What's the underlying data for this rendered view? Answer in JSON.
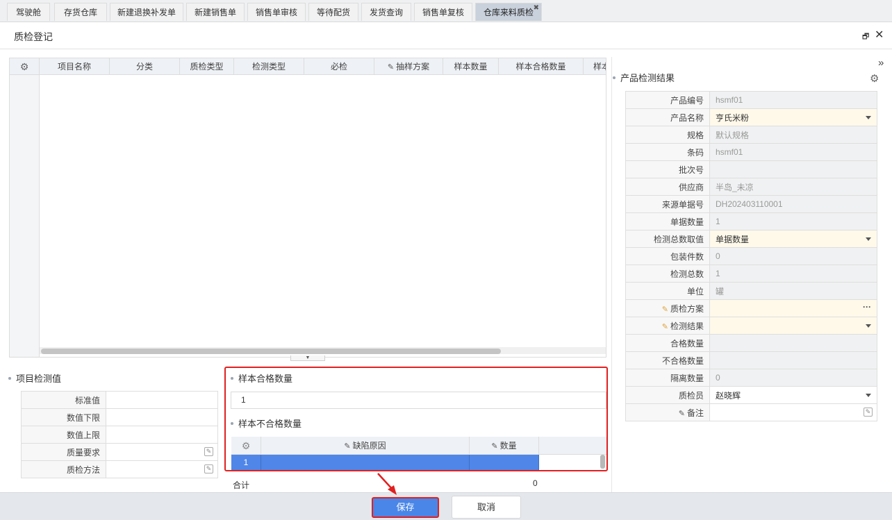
{
  "tabs": [
    {
      "label": "驾驶舱"
    },
    {
      "label": "存货仓库"
    },
    {
      "label": "新建退换补发单"
    },
    {
      "label": "新建销售单"
    },
    {
      "label": "销售单审核"
    },
    {
      "label": "等待配货"
    },
    {
      "label": "发货查询"
    },
    {
      "label": "销售单复核"
    },
    {
      "label": "仓库来料质检"
    }
  ],
  "dialog": {
    "title": "质检登记"
  },
  "grid": {
    "columns": [
      "项目名称",
      "分类",
      "质检类型",
      "检测类型",
      "必检",
      "抽样方案",
      "样本数量",
      "样本合格数量",
      "样本"
    ]
  },
  "item_values": {
    "title": "项目检测值",
    "rows": [
      {
        "label": "标准值",
        "value": ""
      },
      {
        "label": "数值下限",
        "value": ""
      },
      {
        "label": "数值上限",
        "value": ""
      },
      {
        "label": "质量要求",
        "value": ""
      },
      {
        "label": "质检方法",
        "value": ""
      }
    ]
  },
  "sample": {
    "pass_title": "样本合格数量",
    "pass_value": "1",
    "fail_title": "样本不合格数量",
    "defect_columns": [
      "缺陷原因",
      "数量"
    ],
    "defect_rows": [
      {
        "index": "1",
        "reason": "",
        "qty": ""
      }
    ],
    "total_label": "合计",
    "total_value": "0"
  },
  "result": {
    "title": "产品检测结果",
    "fields": [
      {
        "label": "产品编号",
        "value": "hsmf01"
      },
      {
        "label": "产品名称",
        "value": "亨氏米粉"
      },
      {
        "label": "规格",
        "value": "默认规格"
      },
      {
        "label": "条码",
        "value": "hsmf01"
      },
      {
        "label": "批次号",
        "value": ""
      },
      {
        "label": "供应商",
        "value": "半岛_未凉"
      },
      {
        "label": "来源单据号",
        "value": "DH202403110001"
      },
      {
        "label": "单据数量",
        "value": "1"
      },
      {
        "label": "检测总数取值",
        "value": "单据数量"
      },
      {
        "label": "包装件数",
        "value": "0"
      },
      {
        "label": "检测总数",
        "value": "1"
      },
      {
        "label": "单位",
        "value": "罐"
      },
      {
        "label": "质检方案",
        "value": ""
      },
      {
        "label": "检测结果",
        "value": ""
      },
      {
        "label": "合格数量",
        "value": ""
      },
      {
        "label": "不合格数量",
        "value": ""
      },
      {
        "label": "隔离数量",
        "value": "0"
      },
      {
        "label": "质检员",
        "value": "赵晓辉"
      },
      {
        "label": "备注",
        "value": ""
      }
    ]
  },
  "footer": {
    "save_label": "保存",
    "cancel_label": "取消"
  },
  "colors": {
    "accent": "#4a86e8",
    "highlight_border": "#e02020",
    "editable_bg": "#fff9ea"
  }
}
